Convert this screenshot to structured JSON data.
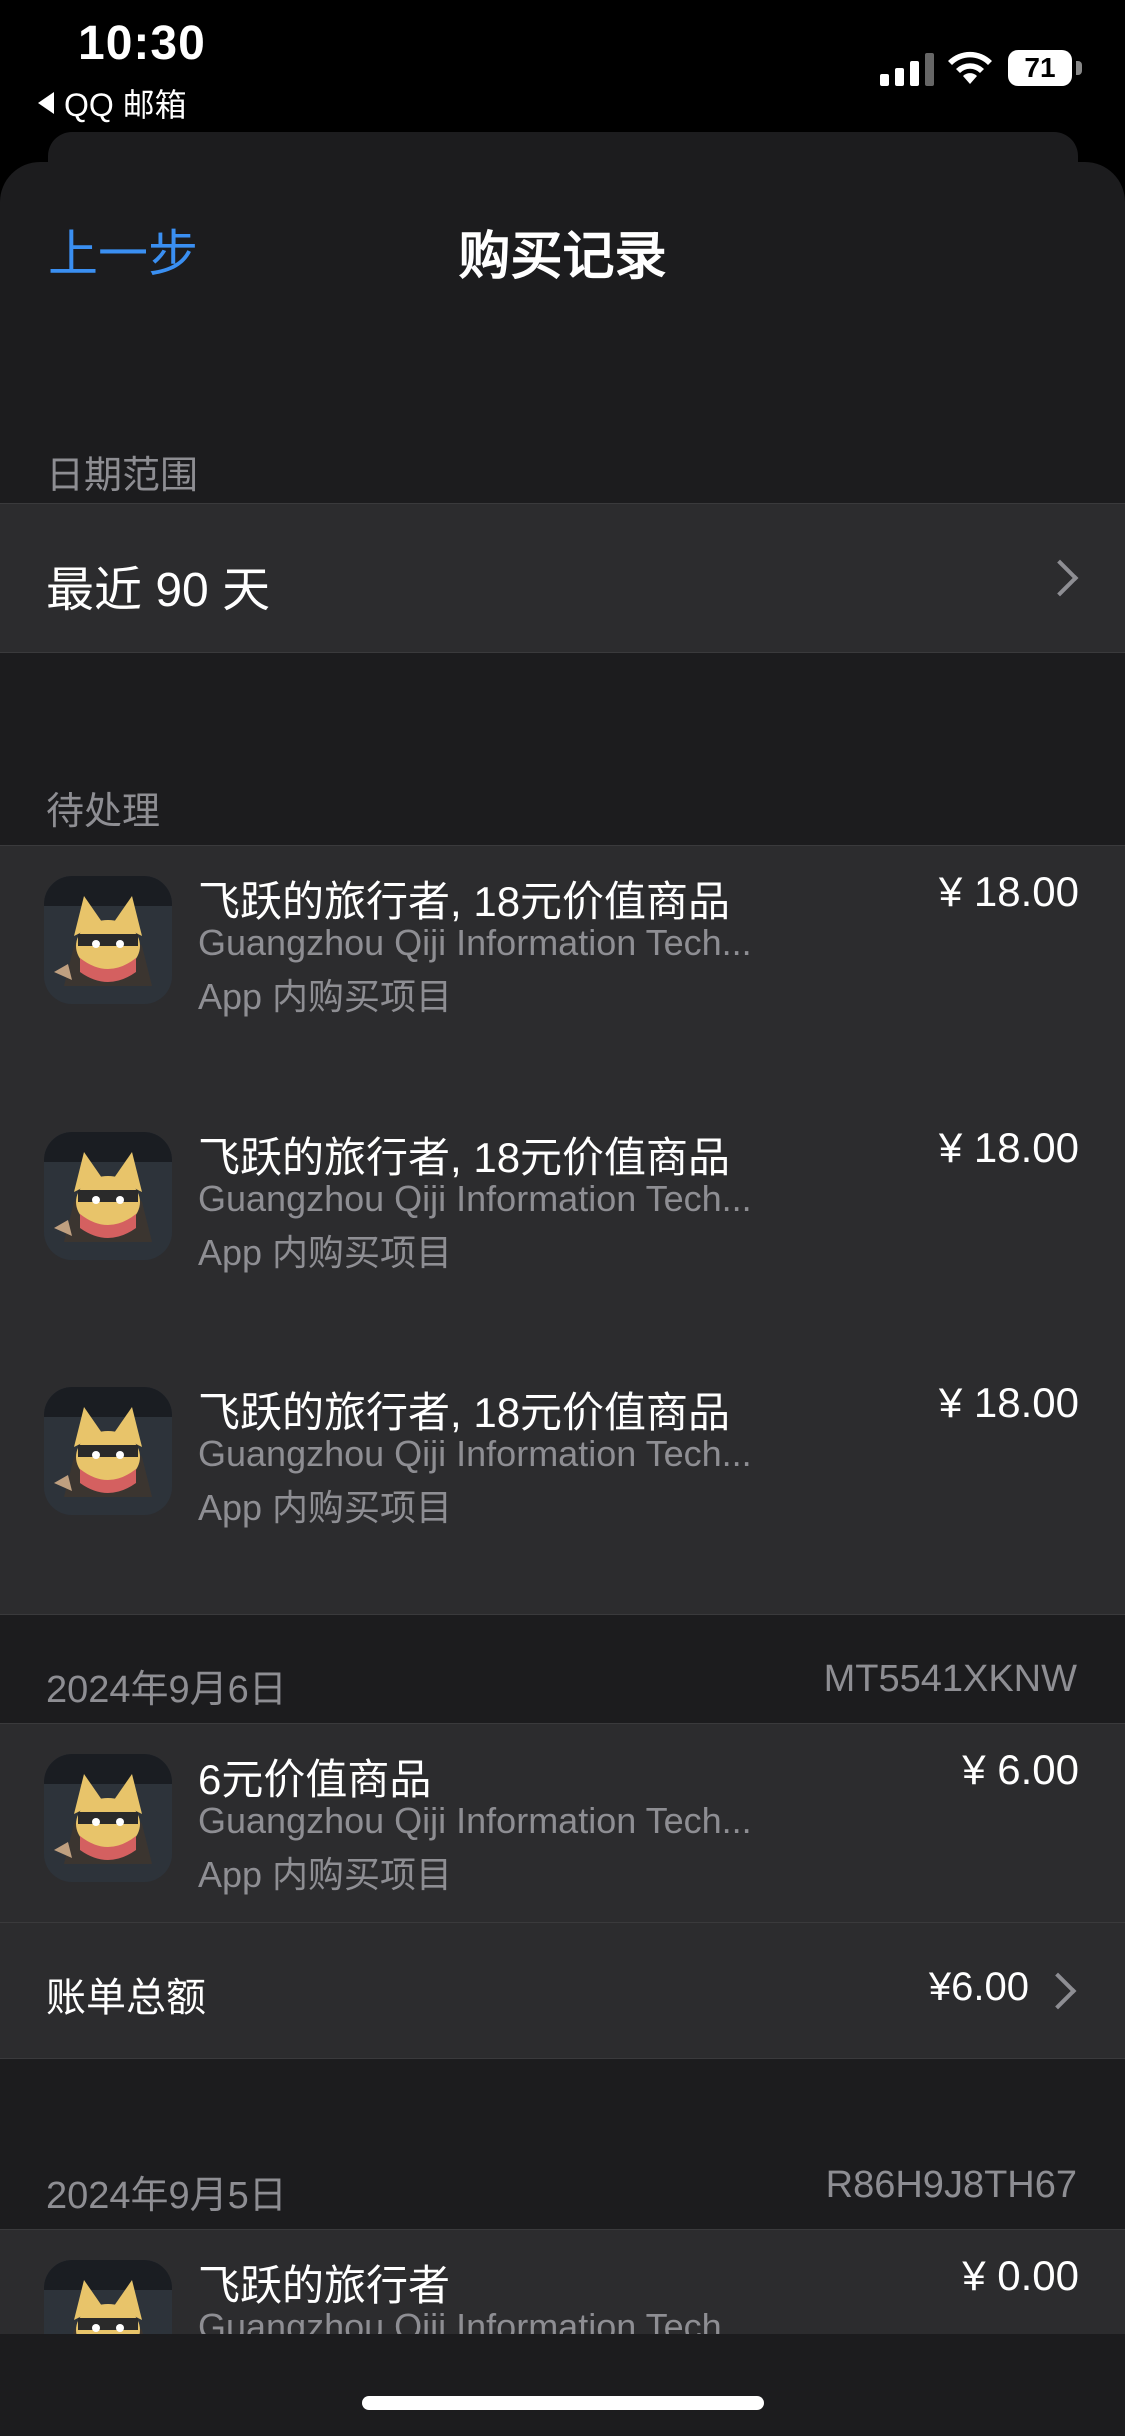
{
  "status_bar": {
    "time": "10:30",
    "back_app": "QQ 邮箱",
    "battery": "71"
  },
  "nav": {
    "back_label": "上一步",
    "title": "购买记录"
  },
  "date_range": {
    "section_label": "日期范围",
    "value": "最近 90 天"
  },
  "pending": {
    "section_label": "待处理",
    "items": [
      {
        "title": "飞跃的旅行者, 18元价值商品",
        "developer": "Guangzhou Qiji Information Tech...",
        "type": "App 内购买项目",
        "price": "¥ 18.00"
      },
      {
        "title": "飞跃的旅行者, 18元价值商品",
        "developer": "Guangzhou Qiji Information Tech...",
        "type": "App 内购买项目",
        "price": "¥ 18.00"
      },
      {
        "title": "飞跃的旅行者, 18元价值商品",
        "developer": "Guangzhou Qiji Information Tech...",
        "type": "App 内购买项目",
        "price": "¥ 18.00"
      }
    ]
  },
  "order1": {
    "date": "2024年9月6日",
    "order_id": "MT5541XKNW",
    "item": {
      "title": "6元价值商品",
      "developer": "Guangzhou Qiji Information Tech...",
      "type": "App 内购买项目",
      "price": "¥ 6.00"
    },
    "total_label": "账单总额",
    "total_value": "¥6.00"
  },
  "order2": {
    "date": "2024年9月5日",
    "order_id": "R86H9J8TH67",
    "item": {
      "title": "飞跃的旅行者",
      "developer": "Guangzhou Qiji Information Tech",
      "price": "¥ 0.00"
    }
  },
  "colors": {
    "accent": "#3a8ff2",
    "background": "#1c1c1e",
    "cell": "#2c2c2e",
    "secondary_text": "#8e8e93"
  }
}
